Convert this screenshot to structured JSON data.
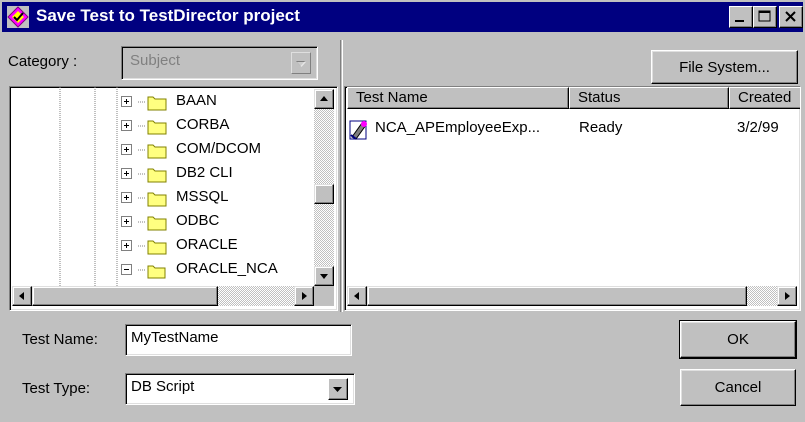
{
  "window": {
    "title": "Save Test to TestDirector project",
    "icon": "testdirector-app-icon",
    "minimize_icon": "minimize-icon",
    "maximize_icon": "maximize-icon",
    "close_icon": "close-icon"
  },
  "category": {
    "label": "Category :",
    "value": "Subject",
    "disabled": true
  },
  "file_system_button": {
    "label": "File System..."
  },
  "tree": {
    "items": [
      {
        "label": "BAAN",
        "icon": "folder-icon",
        "expander": "plus"
      },
      {
        "label": "CORBA",
        "icon": "folder-icon",
        "expander": "plus"
      },
      {
        "label": "COM/DCOM",
        "icon": "folder-icon",
        "expander": "plus"
      },
      {
        "label": "DB2 CLI",
        "icon": "folder-icon",
        "expander": "plus"
      },
      {
        "label": "MSSQL",
        "icon": "folder-icon",
        "expander": "plus"
      },
      {
        "label": "ODBC",
        "icon": "folder-icon",
        "expander": "plus"
      },
      {
        "label": "ORACLE",
        "icon": "folder-icon",
        "expander": "plus"
      },
      {
        "label": "ORACLE_NCA",
        "icon": "open-folder-icon",
        "expander": "minus"
      }
    ]
  },
  "tests_list": {
    "columns": [
      "Test Name",
      "Status",
      "Created"
    ],
    "rows": [
      {
        "name": "NCA_APEmployeeExp...",
        "status": "Ready",
        "created": "3/2/99",
        "icon": "test-script-icon"
      }
    ]
  },
  "form": {
    "test_name_label": "Test Name:",
    "test_name_value": "MyTestName",
    "test_type_label": "Test Type:",
    "test_type_value": "DB Script"
  },
  "buttons": {
    "ok": "OK",
    "cancel": "Cancel"
  },
  "colors": {
    "titlebar": "#000080",
    "face": "#c0c0c0",
    "folder": "#ffff80"
  }
}
